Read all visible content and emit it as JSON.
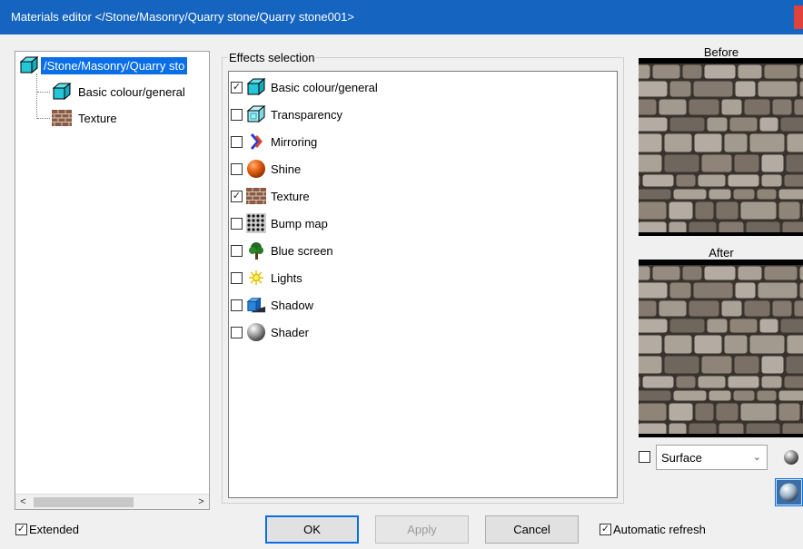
{
  "window": {
    "title": "Materials editor   </Stone/Masonry/Quarry stone/Quarry stone001>"
  },
  "tree": {
    "root_label": "/Stone/Masonry/Quarry sto",
    "children": [
      {
        "label": "Basic colour/general",
        "icon": "cube-icon"
      },
      {
        "label": "Texture",
        "icon": "brick-icon"
      }
    ],
    "scroll_left": "<",
    "scroll_right": ">"
  },
  "effects": {
    "group_title": "Effects selection",
    "items": [
      {
        "label": "Basic colour/general",
        "checked": true,
        "icon": "cube-icon"
      },
      {
        "label": "Transparency",
        "checked": false,
        "icon": "transparent-cube-icon"
      },
      {
        "label": "Mirroring",
        "checked": false,
        "icon": "mirror-arrows-icon"
      },
      {
        "label": "Shine",
        "checked": false,
        "icon": "orange-sphere-icon"
      },
      {
        "label": "Texture",
        "checked": true,
        "icon": "brick-icon"
      },
      {
        "label": "Bump map",
        "checked": false,
        "icon": "dot-grid-icon"
      },
      {
        "label": "Blue screen",
        "checked": false,
        "icon": "tree-icon"
      },
      {
        "label": "Lights",
        "checked": false,
        "icon": "sun-icon"
      },
      {
        "label": "Shadow",
        "checked": false,
        "icon": "shadow-cube-icon"
      },
      {
        "label": "Shader",
        "checked": false,
        "icon": "grey-sphere-icon"
      }
    ]
  },
  "preview": {
    "before_label": "Before",
    "after_label": "After",
    "surface_checked": false,
    "surface_option": "Surface"
  },
  "bottom": {
    "extended_label": "Extended",
    "extended_checked": true,
    "ok_label": "OK",
    "apply_label": "Apply",
    "cancel_label": "Cancel",
    "auto_refresh_label": "Automatic refresh",
    "auto_refresh_checked": true
  },
  "colors": {
    "titlebar": "#1464c0",
    "selection": "#0a6fe6",
    "close": "#e0413a"
  }
}
